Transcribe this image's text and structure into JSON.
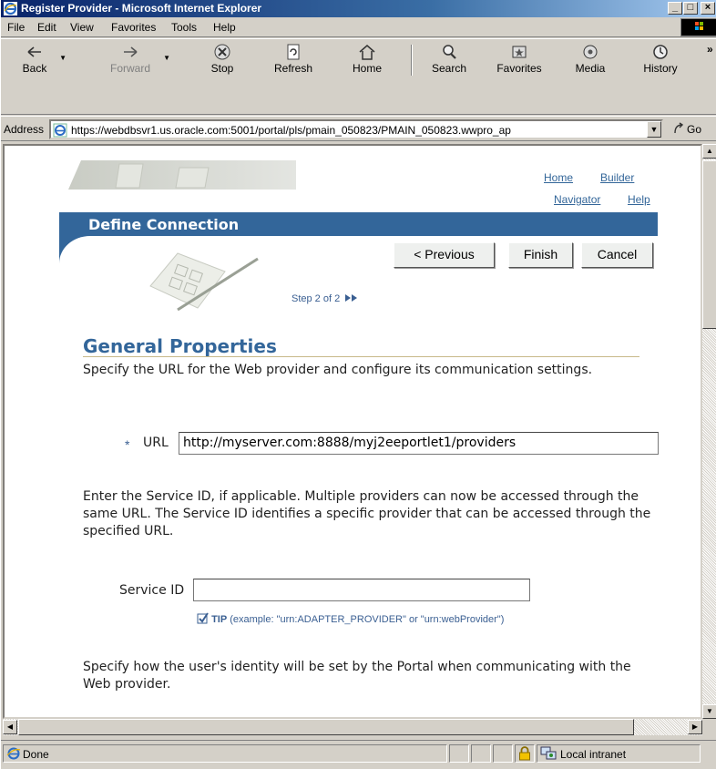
{
  "window": {
    "title": "Register Provider - Microsoft Internet Explorer",
    "minimize_glyph": "_",
    "maximize_glyph": "□",
    "close_glyph": "×"
  },
  "menu": [
    "File",
    "Edit",
    "View",
    "Favorites",
    "Tools",
    "Help"
  ],
  "toolbar": {
    "back": "Back",
    "forward": "Forward",
    "stop": "Stop",
    "refresh": "Refresh",
    "home": "Home",
    "search": "Search",
    "favorites": "Favorites",
    "media": "Media",
    "history": "History",
    "more": "»"
  },
  "address": {
    "label": "Address",
    "url": "https://webdbsvr1.us.oracle.com:5001/portal/pls/pmain_050823/PMAIN_050823.wwpro_ap",
    "go": "Go"
  },
  "page": {
    "links": {
      "home": "Home",
      "builder": "Builder",
      "navigator": "Navigator",
      "help": "Help"
    },
    "header_title": "Define Connection",
    "buttons": {
      "previous": "< Previous",
      "finish": "Finish",
      "cancel": "Cancel"
    },
    "step": "Step 2 of 2",
    "section_title": "General Properties",
    "intro": "Specify the URL for the Web provider and configure its communication settings.",
    "required_marker": "*",
    "url_label": "URL",
    "url_value": "http://myserver.com:8888/myj2eeportlet1/providers",
    "service_para": "Enter the Service ID, if applicable. Multiple providers can now be accessed through the same URL. The Service ID identifies a specific provider that can be accessed through the specified URL.",
    "service_label": "Service ID",
    "service_value": "",
    "tip_label": "TIP",
    "tip_text": "(example: \"urn:ADAPTER_PROVIDER\" or \"urn:webProvider\")",
    "identity_para": "Specify how the user's identity will be set by the Portal when communicating with the Web provider."
  },
  "status": {
    "text": "Done",
    "zone": "Local intranet"
  }
}
